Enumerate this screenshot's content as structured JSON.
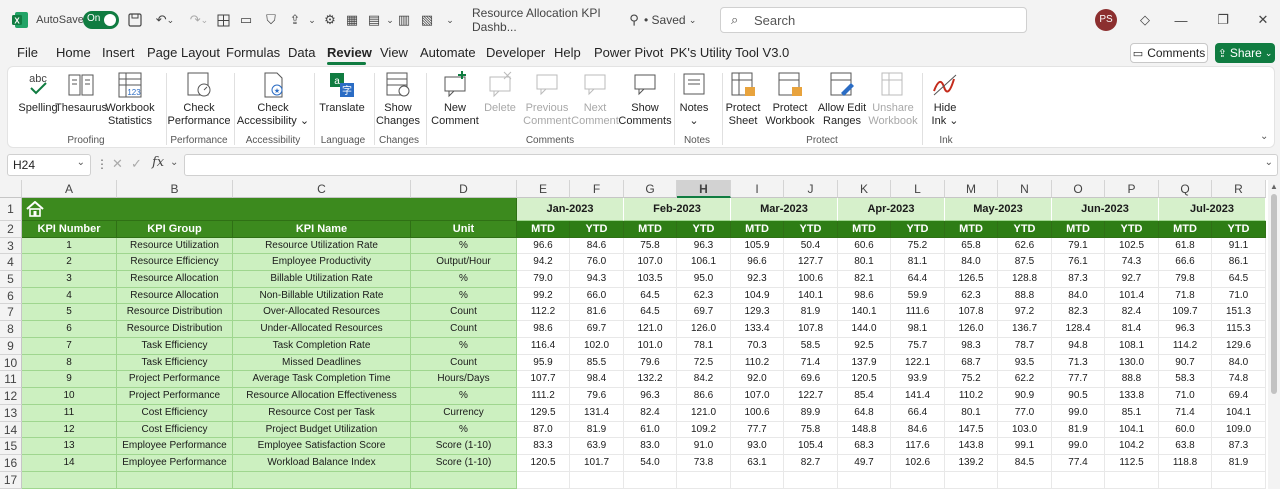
{
  "titlebar": {
    "autosave_label": "AutoSave",
    "autosave_state": "On",
    "doc_title": "Resource Allocation KPI Dashb...",
    "saved_label": "• Saved",
    "search_placeholder": "Search",
    "user_initials": "PS"
  },
  "menu": [
    "File",
    "Home",
    "Insert",
    "Page Layout",
    "Formulas",
    "Data",
    "Review",
    "View",
    "Automate",
    "Developer",
    "Help",
    "Power Pivot",
    "PK's Utility Tool V3.0"
  ],
  "menu_active": "Review",
  "menu_right": {
    "comments_label": "Comments",
    "share_label": "Share"
  },
  "ribbon": {
    "spelling": "Spelling",
    "thesaurus": "Thesaurus",
    "workbook_statistics_1": "Workbook",
    "workbook_statistics_2": "Statistics",
    "check_performance_1": "Check",
    "check_performance_2": "Performance",
    "check_accessibility_1": "Check",
    "check_accessibility_2": "Accessibility",
    "translate": "Translate",
    "show_changes_1": "Show",
    "show_changes_2": "Changes",
    "new_comment_1": "New",
    "new_comment_2": "Comment",
    "delete": "Delete",
    "previous_comment_1": "Previous",
    "previous_comment_2": "Comment",
    "next_comment_1": "Next",
    "next_comment_2": "Comment",
    "show_comments_1": "Show",
    "show_comments_2": "Comments",
    "notes": "Notes",
    "protect_sheet_1": "Protect",
    "protect_sheet_2": "Sheet",
    "protect_workbook_1": "Protect",
    "protect_workbook_2": "Workbook",
    "allow_edit_ranges_1": "Allow Edit",
    "allow_edit_ranges_2": "Ranges",
    "unshare_workbook_1": "Unshare",
    "unshare_workbook_2": "Workbook",
    "hide_ink_1": "Hide",
    "hide_ink_2": "Ink",
    "groups": {
      "proofing": "Proofing",
      "performance": "Performance",
      "accessibility": "Accessibility",
      "language": "Language",
      "changes": "Changes",
      "comments": "Comments",
      "notes": "Notes",
      "protect": "Protect",
      "ink": "Ink"
    }
  },
  "formula_bar": {
    "name_box": "H24",
    "fx": "fx",
    "value": ""
  },
  "columns": [
    "A",
    "B",
    "C",
    "D",
    "E",
    "F",
    "G",
    "H",
    "I",
    "J",
    "K",
    "L",
    "M",
    "N",
    "O",
    "P",
    "Q",
    "R"
  ],
  "row_numbers": [
    "1",
    "2",
    "3",
    "4",
    "5",
    "6",
    "7",
    "8",
    "9",
    "10",
    "11",
    "12",
    "13",
    "14",
    "15",
    "16",
    "17"
  ],
  "headers": {
    "kpi_number": "KPI Number",
    "kpi_group": "KPI Group",
    "kpi_name": "KPI Name",
    "unit": "Unit"
  },
  "months": [
    "Jan-2023",
    "Feb-2023",
    "Mar-2023",
    "Apr-2023",
    "May-2023",
    "Jun-2023",
    "Jul-2023"
  ],
  "sub_headers": [
    "MTD",
    "YTD"
  ],
  "rows": [
    {
      "num": "1",
      "group": "Resource Utilization",
      "name": "Resource Utilization Rate",
      "unit": "%",
      "values": [
        "96.6",
        "84.6",
        "75.8",
        "96.3",
        "105.9",
        "50.4",
        "60.6",
        "75.2",
        "65.8",
        "62.6",
        "79.1",
        "102.5",
        "61.8",
        "91.1"
      ]
    },
    {
      "num": "2",
      "group": "Resource Efficiency",
      "name": "Employee Productivity",
      "unit": "Output/Hour",
      "values": [
        "94.2",
        "76.0",
        "107.0",
        "106.1",
        "96.6",
        "127.7",
        "80.1",
        "81.1",
        "84.0",
        "87.5",
        "76.1",
        "74.3",
        "66.6",
        "86.1"
      ]
    },
    {
      "num": "3",
      "group": "Resource Allocation",
      "name": "Billable Utilization Rate",
      "unit": "%",
      "values": [
        "79.0",
        "94.3",
        "103.5",
        "95.0",
        "92.3",
        "100.6",
        "82.1",
        "64.4",
        "126.5",
        "128.8",
        "87.3",
        "92.7",
        "79.8",
        "64.5"
      ]
    },
    {
      "num": "4",
      "group": "Resource Allocation",
      "name": "Non-Billable Utilization Rate",
      "unit": "%",
      "values": [
        "99.2",
        "66.0",
        "64.5",
        "62.3",
        "104.9",
        "140.1",
        "98.6",
        "59.9",
        "62.3",
        "88.8",
        "84.0",
        "101.4",
        "71.8",
        "71.0"
      ]
    },
    {
      "num": "5",
      "group": "Resource Distribution",
      "name": "Over-Allocated Resources",
      "unit": "Count",
      "values": [
        "112.2",
        "81.6",
        "64.5",
        "69.7",
        "129.3",
        "81.9",
        "140.1",
        "111.6",
        "107.8",
        "97.2",
        "82.3",
        "82.4",
        "109.7",
        "151.3"
      ]
    },
    {
      "num": "6",
      "group": "Resource Distribution",
      "name": "Under-Allocated Resources",
      "unit": "Count",
      "values": [
        "98.6",
        "69.7",
        "121.0",
        "126.0",
        "133.4",
        "107.8",
        "144.0",
        "98.1",
        "126.0",
        "136.7",
        "128.4",
        "81.4",
        "96.3",
        "115.3"
      ]
    },
    {
      "num": "7",
      "group": "Task Efficiency",
      "name": "Task Completion Rate",
      "unit": "%",
      "values": [
        "116.4",
        "102.0",
        "101.0",
        "78.1",
        "70.3",
        "58.5",
        "92.5",
        "75.7",
        "98.3",
        "78.7",
        "94.8",
        "108.1",
        "114.2",
        "129.6"
      ]
    },
    {
      "num": "8",
      "group": "Task Efficiency",
      "name": "Missed Deadlines",
      "unit": "Count",
      "values": [
        "95.9",
        "85.5",
        "79.6",
        "72.5",
        "110.2",
        "71.4",
        "137.9",
        "122.1",
        "68.7",
        "93.5",
        "71.3",
        "130.0",
        "90.7",
        "84.0"
      ]
    },
    {
      "num": "9",
      "group": "Project Performance",
      "name": "Average Task Completion Time",
      "unit": "Hours/Days",
      "values": [
        "107.7",
        "98.4",
        "132.2",
        "84.2",
        "92.0",
        "69.6",
        "120.5",
        "93.9",
        "75.2",
        "62.2",
        "77.7",
        "88.8",
        "58.3",
        "74.8"
      ]
    },
    {
      "num": "10",
      "group": "Project Performance",
      "name": "Resource Allocation Effectiveness",
      "unit": "%",
      "values": [
        "111.2",
        "79.6",
        "96.3",
        "86.6",
        "107.0",
        "122.7",
        "85.4",
        "141.4",
        "110.2",
        "90.9",
        "90.5",
        "133.8",
        "71.0",
        "69.4"
      ]
    },
    {
      "num": "11",
      "group": "Cost Efficiency",
      "name": "Resource Cost per Task",
      "unit": "Currency",
      "values": [
        "129.5",
        "131.4",
        "82.4",
        "121.0",
        "100.6",
        "89.9",
        "64.8",
        "66.4",
        "80.1",
        "77.0",
        "99.0",
        "85.1",
        "71.4",
        "104.1"
      ]
    },
    {
      "num": "12",
      "group": "Cost Efficiency",
      "name": "Project Budget Utilization",
      "unit": "%",
      "values": [
        "87.0",
        "81.9",
        "61.0",
        "109.2",
        "77.7",
        "75.8",
        "148.8",
        "84.6",
        "147.5",
        "103.0",
        "81.9",
        "104.1",
        "60.0",
        "109.0"
      ]
    },
    {
      "num": "13",
      "group": "Employee Performance",
      "name": "Employee Satisfaction Score",
      "unit": "Score (1-10)",
      "values": [
        "83.3",
        "63.9",
        "83.0",
        "91.0",
        "93.0",
        "105.4",
        "68.3",
        "117.6",
        "143.8",
        "99.1",
        "99.0",
        "104.2",
        "63.8",
        "87.3"
      ]
    },
    {
      "num": "14",
      "group": "Employee Performance",
      "name": "Workload Balance Index",
      "unit": "Score (1-10)",
      "values": [
        "120.5",
        "101.7",
        "54.0",
        "73.8",
        "63.1",
        "82.7",
        "49.7",
        "102.6",
        "139.2",
        "84.5",
        "77.4",
        "112.5",
        "118.8",
        "81.9"
      ]
    }
  ]
}
